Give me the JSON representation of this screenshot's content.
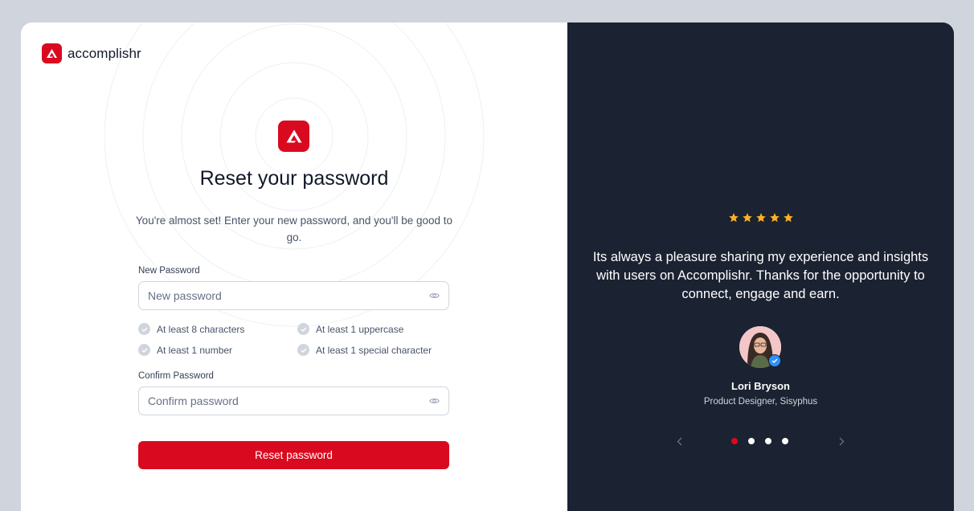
{
  "brand": {
    "name": "accomplishr",
    "logo_icon": "accomplishr-logo-icon",
    "accent": "#d90a1f"
  },
  "form": {
    "title": "Reset your password",
    "subtitle": "You're almost set! Enter your new password, and you'll be good to go.",
    "new_password": {
      "label": "New Password",
      "placeholder": "New password",
      "value": "",
      "toggle_icon": "eye-icon"
    },
    "requirements": [
      {
        "label": "At least 8 characters",
        "met": false
      },
      {
        "label": "At least 1 uppercase",
        "met": false
      },
      {
        "label": "At least 1 number",
        "met": false
      },
      {
        "label": "At least 1 special character",
        "met": false
      }
    ],
    "confirm_password": {
      "label": "Confirm Password",
      "placeholder": "Confirm password",
      "value": "",
      "toggle_icon": "eye-icon"
    },
    "submit_label": "Reset password"
  },
  "testimonial": {
    "rating": 5,
    "rating_max": 5,
    "quote": "Its always a pleasure sharing my experience and insights with users on Accomplishr. Thanks for the opportunity to connect, engage and earn.",
    "author": {
      "name": "Lori Bryson",
      "role": "Product Designer, Sisyphus",
      "verified": true
    },
    "carousel": {
      "count": 4,
      "active_index": 0,
      "prev_icon": "chevron-left-icon",
      "next_icon": "chevron-right-icon"
    },
    "star_color": "#fdb022",
    "panel_color": "#1b2231"
  }
}
